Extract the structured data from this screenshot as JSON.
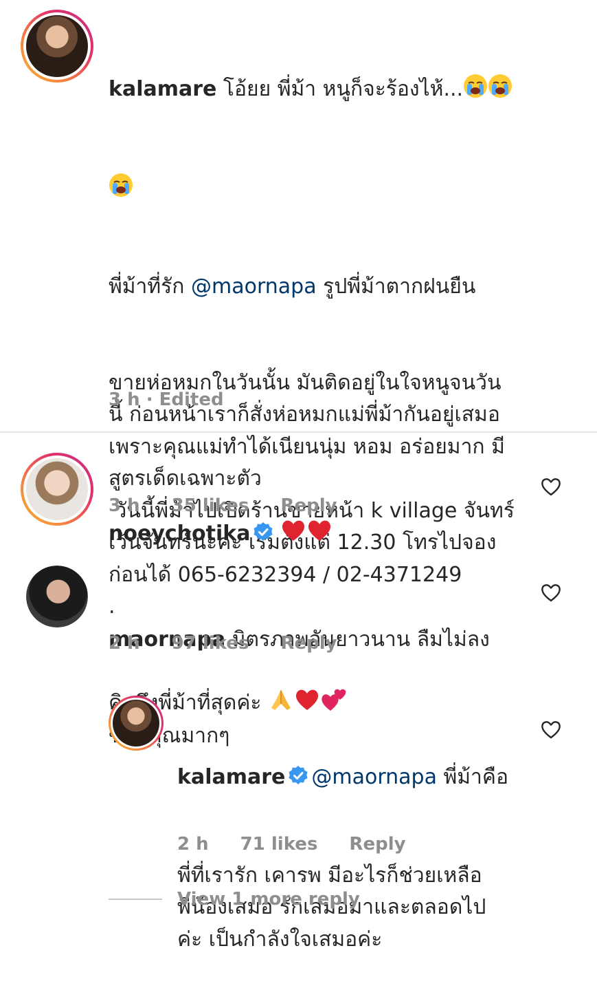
{
  "caption": {
    "username": "kalamare",
    "line1_text": " โอ้ยย พี่ม้า หนูก็จะร้องไห้...",
    "line3_prefix": "พี่ม้าที่รัก ",
    "line3_mention": "@maornapa",
    "line3_suffix": " รูปพี่ม้าตากฝนยืน",
    "body": "ขายห่อหมกในวันนั้น มันติดอยู่ในใจหนูจนวัน\nนี้ ก่อนหน้าเราก็สั่งห่อหมกแม่พี่ม้ากันอยู่เสมอ\nเพราะคุณแม่ทำได้เนียนนุ่ม หอม อร่อยมาก มี\nสูตรเด็ดเฉพาะตัว\n วันนี้พี่ม้าไปเปิดร้านขายหน้า k village จันทร์\nเว้นจันทร์นะคะ เริ่มตั้งแต่ 12.30 โทรไปจอง\nก่อนได้ 065-6232394 / 02-4371249\n.",
    "last_line": "คิดถึงพี่ม้าที่สุดค่ะ ",
    "time": "3 h · Edited"
  },
  "comments": [
    {
      "username": "noeychotika",
      "verified": true,
      "text": "",
      "time": "3 h",
      "likes": "35 likes",
      "reply": "Reply"
    },
    {
      "username": "maornapa",
      "verified": false,
      "text_line1": " มิตรภาพอันยาวนาน ลืมไม่ลง",
      "text_line2": "ขอบคุณมากๆ",
      "time": "2 h",
      "likes": "97 likes",
      "reply": "Reply"
    },
    {
      "username": "kalamare",
      "verified": true,
      "mention": "@maornapa",
      "text_line1": " พี่ม้าคือ",
      "text_rest": "พี่ที่เรารัก เคารพ มีอะไรก็ช่วยเหลือ\nพี่น้องเสมอ รักเสมอมาและตลอดไป\nค่ะ เป็นกำลังใจเสมอค่ะ",
      "time": "2 h",
      "likes": "71 likes",
      "reply": "Reply"
    }
  ],
  "view_more": "View 1 more reply",
  "icons": {
    "heart_outline": "heart-icon",
    "verified_badge": "verified-badge-icon",
    "crying_emoji": "loudly-crying-face-emoji",
    "red_heart_emoji": "red-heart-emoji",
    "praying_hands_emoji": "folded-hands-emoji",
    "two_hearts_emoji": "two-hearts-emoji"
  },
  "colors": {
    "verified_blue": "#3897f0",
    "mention": "#00376b",
    "meta_gray": "#8e8e8e",
    "heart_red": "#e0242f"
  }
}
